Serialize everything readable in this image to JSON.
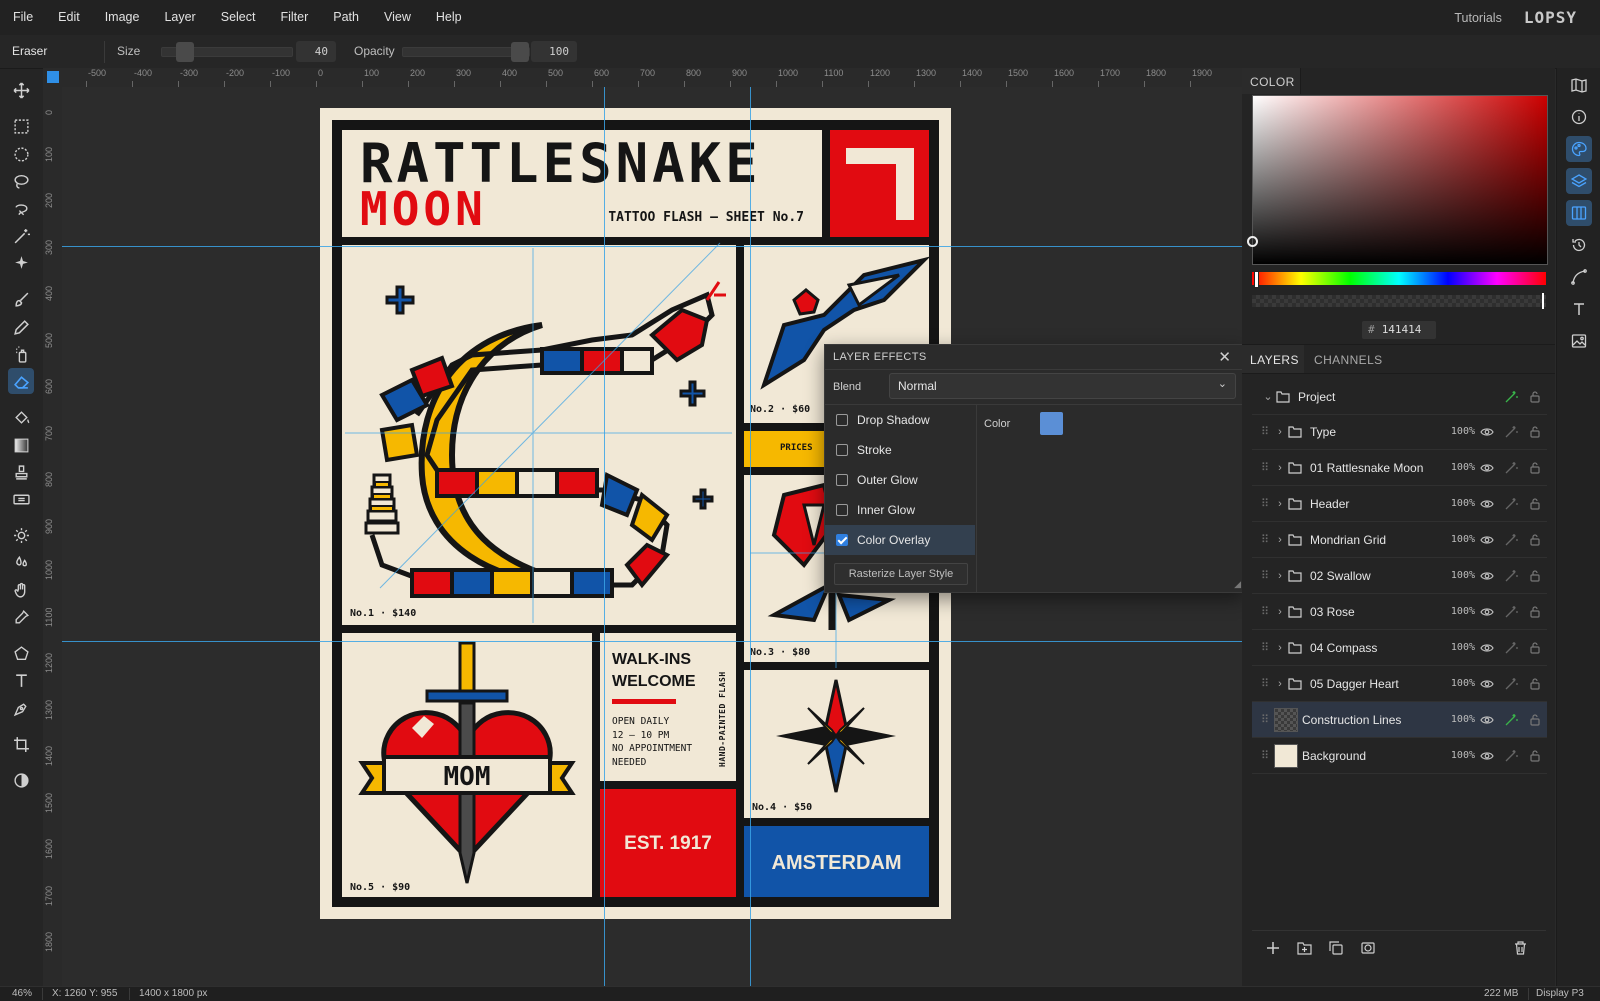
{
  "menu": {
    "items": [
      "File",
      "Edit",
      "Image",
      "Layer",
      "Select",
      "Filter",
      "Path",
      "View",
      "Help"
    ],
    "tutorials": "Tutorials",
    "logo": "LOPSY"
  },
  "options": {
    "tool_name": "Eraser",
    "size_label": "Size",
    "size_value": "40",
    "opacity_label": "Opacity",
    "opacity_value": "100"
  },
  "ruler": {
    "top_ticks": [
      "-500",
      "-400",
      "-300",
      "-200",
      "-100",
      "0",
      "100",
      "200",
      "300",
      "400",
      "500",
      "600",
      "700",
      "800",
      "900",
      "1000",
      "1100",
      "1200",
      "1300",
      "1400",
      "1500",
      "1600",
      "1700",
      "1800",
      "1900"
    ],
    "left_ticks": [
      "0",
      "100",
      "200",
      "300",
      "400",
      "500",
      "600",
      "700",
      "800",
      "900",
      "1000",
      "1100",
      "1200",
      "1300",
      "1400",
      "1500",
      "1600",
      "1700",
      "1800"
    ]
  },
  "poster": {
    "title_line1": "RATTLESNAKE",
    "title_line2": "MOON",
    "subtitle": "TATTOO FLASH — SHEET No.7",
    "item1": "No.1 · $140",
    "item2": "No.2 · $60",
    "item3": "No.3 · $80",
    "item4": "No.4 · $50",
    "item5": "No.5 · $90",
    "prices_tag": "PRICES",
    "walkins": "WALK-INS",
    "welcome": "WELCOME",
    "hours1": "OPEN DAILY",
    "hours2": "12 — 10 PM",
    "hours3": "NO APPOINTMENT",
    "hours4": "NEEDED",
    "vertical": "HAND-PAINTED FLASH",
    "mom": "MOM",
    "est": "EST. 1917",
    "city": "AMSTERDAM"
  },
  "color_panel": {
    "tab": "COLOR",
    "hex_prefix": "#",
    "hex": "141414"
  },
  "layers_panel": {
    "tab_layers": "LAYERS",
    "tab_channels": "CHANNELS",
    "project": "Project",
    "rows": [
      {
        "name": "Type",
        "opacity": "100%"
      },
      {
        "name": "01 Rattlesnake Moon",
        "opacity": "100%"
      },
      {
        "name": "Header",
        "opacity": "100%"
      },
      {
        "name": "Mondrian Grid",
        "opacity": "100%"
      },
      {
        "name": "02 Swallow",
        "opacity": "100%"
      },
      {
        "name": "03 Rose",
        "opacity": "100%"
      },
      {
        "name": "04 Compass",
        "opacity": "100%"
      },
      {
        "name": "05 Dagger Heart",
        "opacity": "100%"
      },
      {
        "name": "Construction Lines",
        "opacity": "100%"
      },
      {
        "name": "Background",
        "opacity": "100%"
      }
    ]
  },
  "layer_effects": {
    "title": "LAYER EFFECTS",
    "blend_label": "Blend",
    "blend_value": "Normal",
    "effects": [
      "Drop Shadow",
      "Stroke",
      "Outer Glow",
      "Inner Glow",
      "Color Overlay"
    ],
    "checked": [
      false,
      false,
      false,
      false,
      true
    ],
    "rasterize": "Rasterize Layer Style",
    "color_label": "Color",
    "overlay_color": "#5b8fd6"
  },
  "status": {
    "zoom": "46%",
    "coords": "X: 1260 Y: 955",
    "doc_size": "1400 x 1800 px",
    "memory": "222 MB",
    "profile": "Display P3"
  },
  "colors": {
    "accent": "#2f7fe0",
    "red": "#e10b11",
    "blue": "#1154a8",
    "yellow": "#f6b800",
    "cream": "#f1e8d6",
    "ink": "#151515"
  }
}
